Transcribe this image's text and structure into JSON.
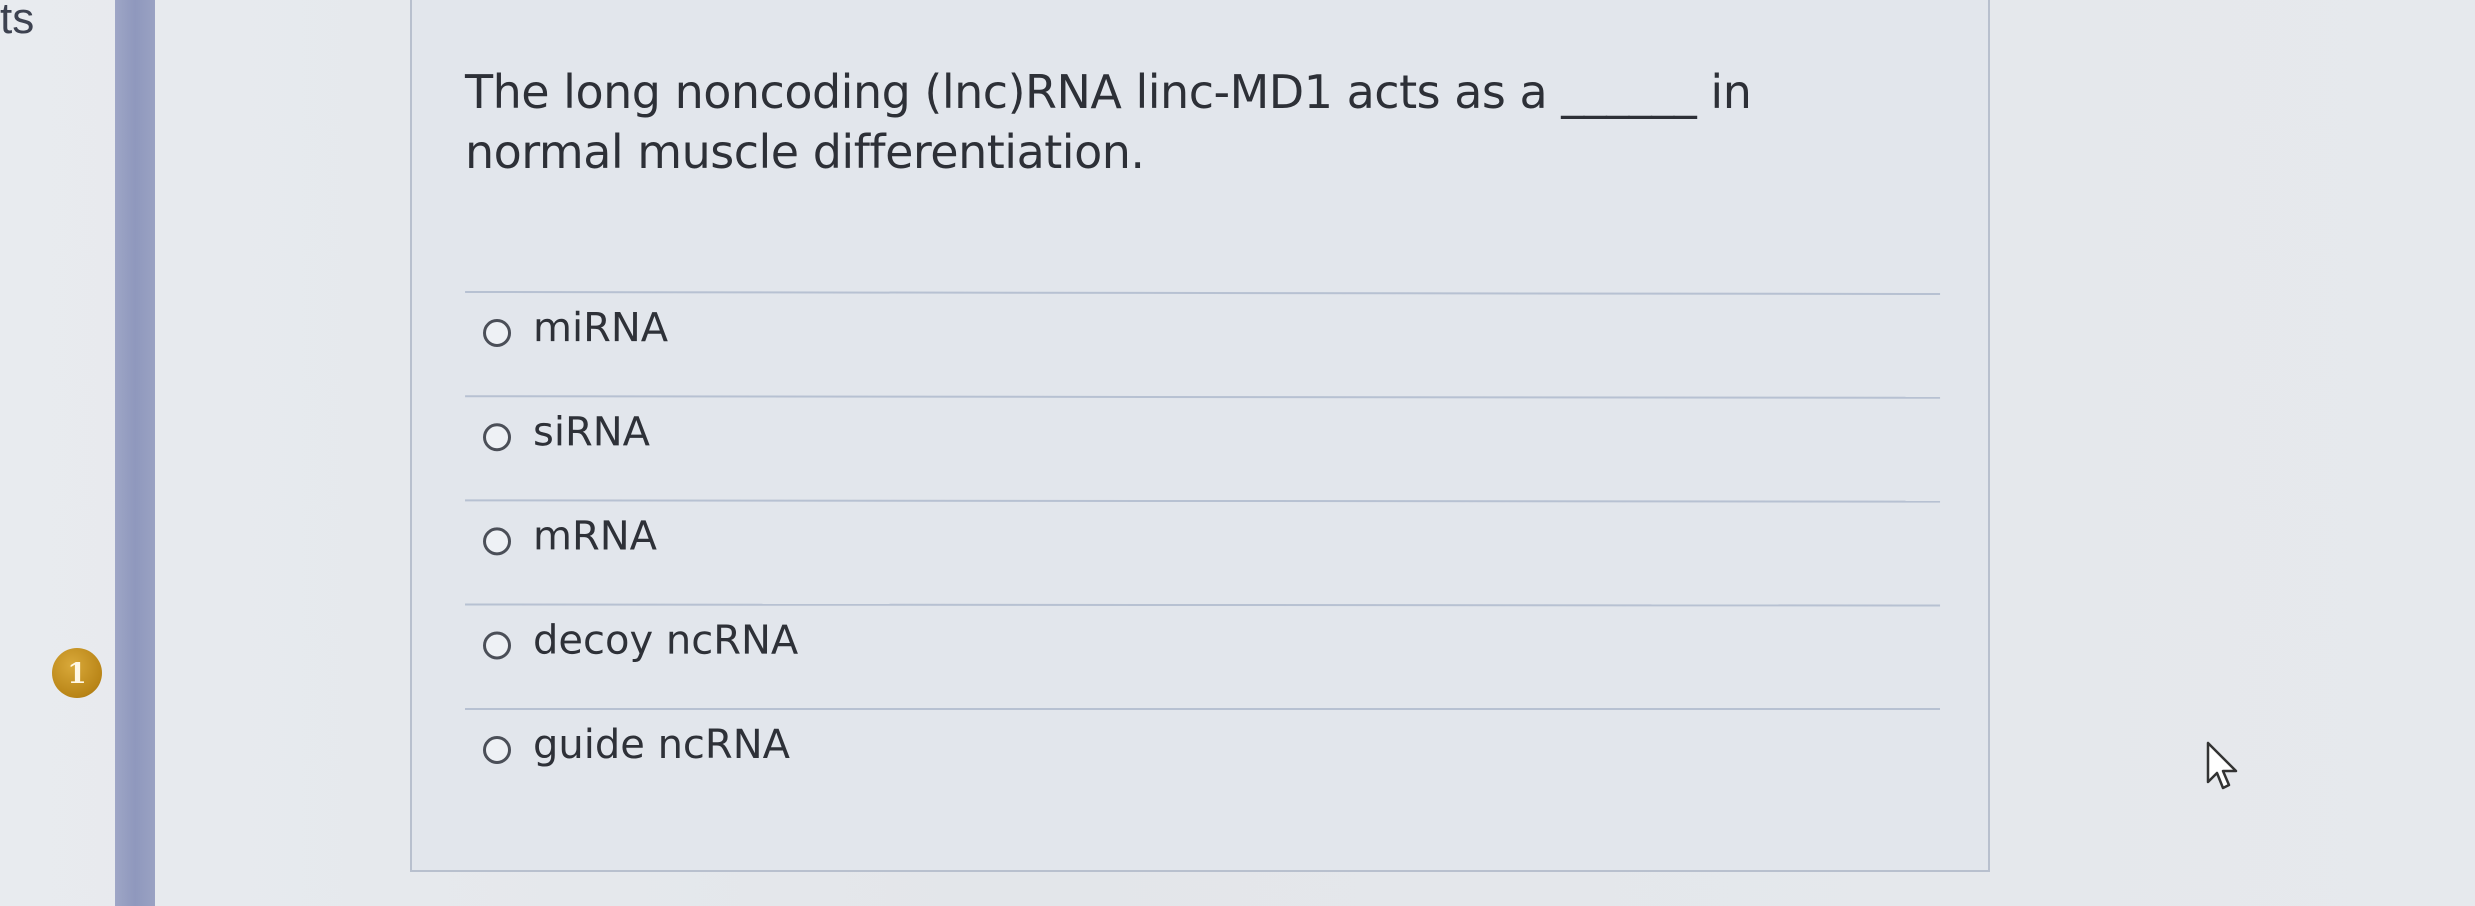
{
  "sidebar": {
    "tab_text": "ts",
    "question_number": "1"
  },
  "question": {
    "text": "The long noncoding (lnc)RNA linc-MD1 acts as a ______ in normal muscle differentiation.",
    "options": [
      "miRNA",
      "siRNA",
      "mRNA",
      "decoy ncRNA",
      "guide ncRNA"
    ]
  },
  "colors": {
    "background": "#e7eaee",
    "sidebar_bar": "#9ea6c6",
    "badge": "#b98517",
    "option_divider": "#b7c1d2"
  },
  "icons": {
    "cursor": "arrow-pointer-icon",
    "radio": "radio-button-icon"
  }
}
